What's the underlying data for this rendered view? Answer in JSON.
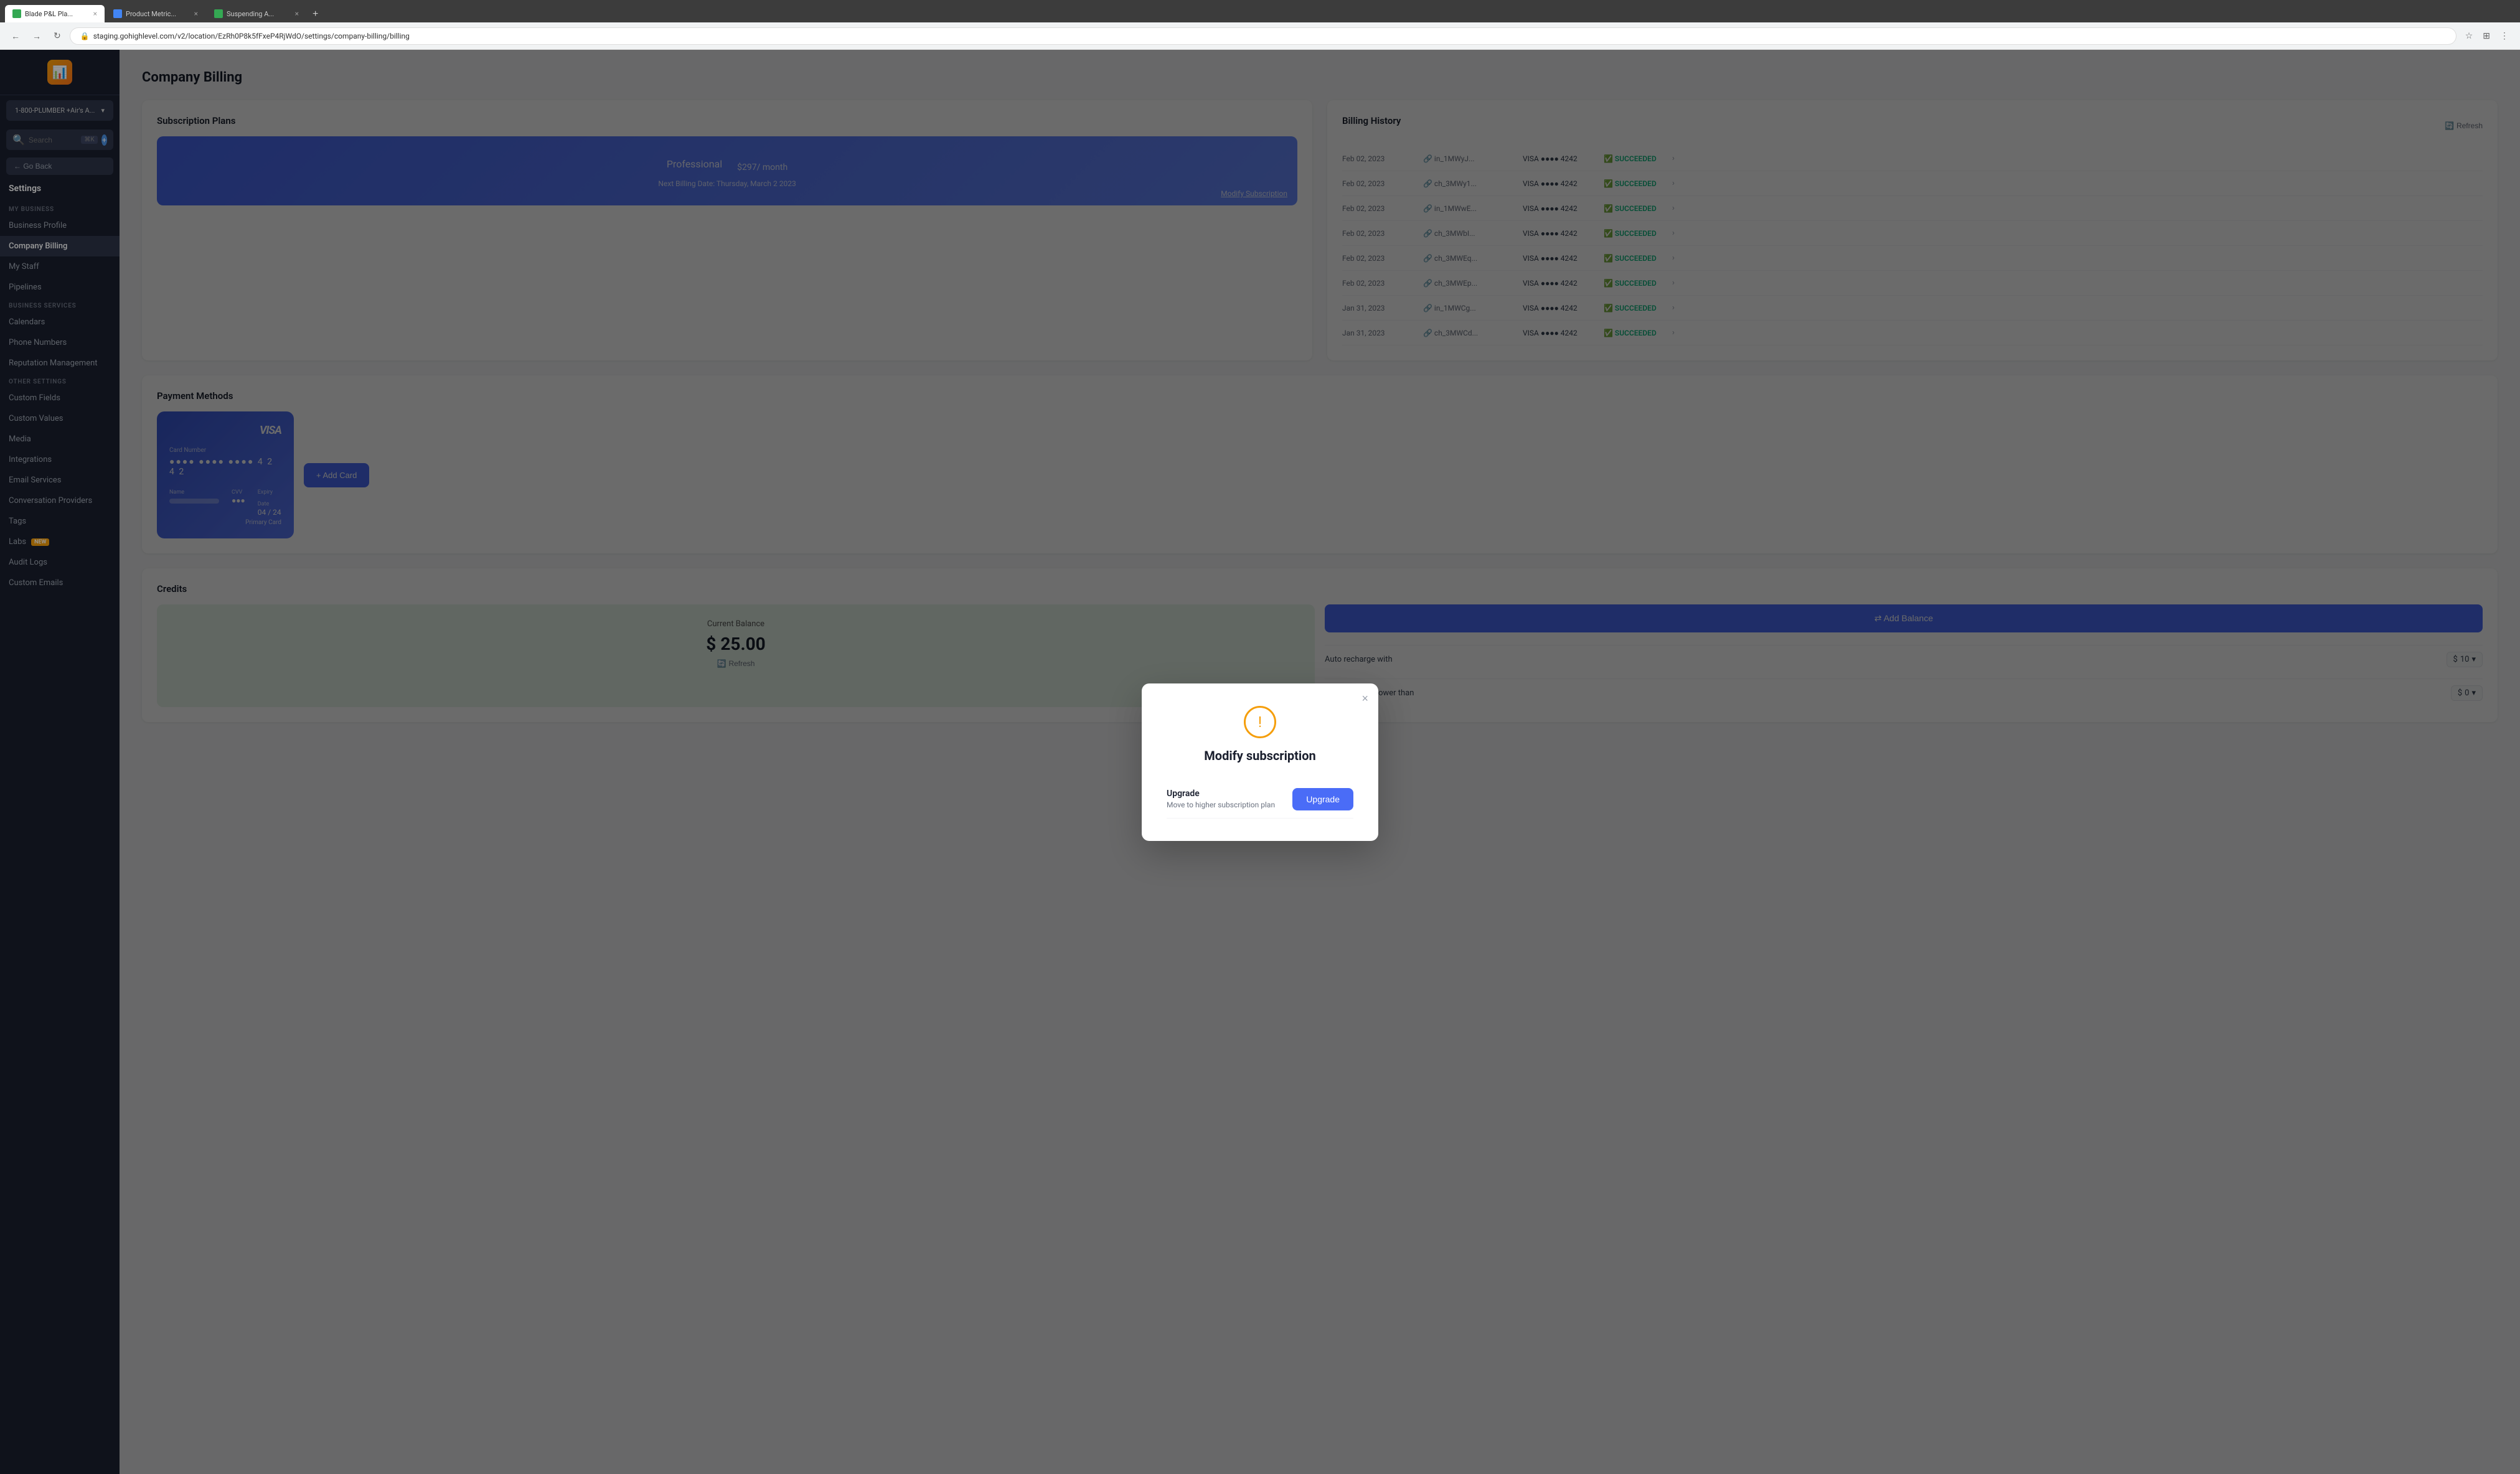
{
  "browser": {
    "url": "staging.gohighlevel.com/v2/location/EzRh0P8k5fFxeP4RjWdO/settings/company-billing/billing",
    "tabs": [
      {
        "label": "Blade P&L Pla...",
        "active": true,
        "color": "green"
      },
      {
        "label": "Product Metric...",
        "active": false,
        "color": "blue"
      },
      {
        "label": "Suspending A...",
        "active": false,
        "color": "green"
      }
    ]
  },
  "sidebar": {
    "logo_emoji": "📊",
    "location": "1-800-PLUMBER +Air's A...",
    "search_placeholder": "Search",
    "search_shortcut": "⌘K",
    "go_back": "← Go Back",
    "settings_label": "Settings",
    "sections": [
      {
        "label": "MY BUSINESS",
        "items": [
          {
            "name": "business-profile",
            "label": "Business Profile",
            "active": false
          },
          {
            "name": "company-billing",
            "label": "Company Billing",
            "active": true
          },
          {
            "name": "my-staff",
            "label": "My Staff",
            "active": false
          },
          {
            "name": "pipelines",
            "label": "Pipelines",
            "active": false
          }
        ]
      },
      {
        "label": "BUSINESS SERVICES",
        "items": [
          {
            "name": "calendars",
            "label": "Calendars",
            "active": false
          },
          {
            "name": "phone-numbers",
            "label": "Phone Numbers",
            "active": false
          },
          {
            "name": "reputation-management",
            "label": "Reputation Management",
            "active": false
          }
        ]
      },
      {
        "label": "OTHER SETTINGS",
        "items": [
          {
            "name": "custom-fields",
            "label": "Custom Fields",
            "active": false
          },
          {
            "name": "custom-values",
            "label": "Custom Values",
            "active": false
          },
          {
            "name": "media",
            "label": "Media",
            "active": false
          },
          {
            "name": "integrations",
            "label": "Integrations",
            "active": false
          },
          {
            "name": "email-services",
            "label": "Email Services",
            "active": false
          },
          {
            "name": "conversation-providers",
            "label": "Conversation Providers",
            "active": false
          },
          {
            "name": "tags",
            "label": "Tags",
            "active": false
          },
          {
            "name": "labs",
            "label": "Labs",
            "active": false,
            "badge": "NEW"
          },
          {
            "name": "audit-logs",
            "label": "Audit Logs",
            "active": false
          },
          {
            "name": "custom-emails",
            "label": "Custom Emails",
            "active": false
          }
        ]
      }
    ]
  },
  "page": {
    "title": "Company Billing"
  },
  "subscription_plans": {
    "title": "Subscription Plans",
    "plan_name": "Professional",
    "plan_price": "$297",
    "plan_period": "/ month",
    "billing_date_label": "Next Billing Date: Thursday, March 2 2023",
    "modify_link": "Modify Subscription"
  },
  "billing_history": {
    "title": "Billing History",
    "refresh_label": "Refresh",
    "rows": [
      {
        "date": "Feb 02, 2023",
        "id": "in_1MWyJ...",
        "card": "VISA ●●●● 4242",
        "status": "SUCCEEDED"
      },
      {
        "date": "Feb 02, 2023",
        "id": "ch_3MWy1...",
        "card": "VISA ●●●● 4242",
        "status": "SUCCEEDED"
      },
      {
        "date": "Feb 02, 2023",
        "id": "in_1MWwE...",
        "card": "VISA ●●●● 4242",
        "status": "SUCCEEDED"
      },
      {
        "date": "Feb 02, 2023",
        "id": "ch_3MWbI...",
        "card": "VISA ●●●● 4242",
        "status": "SUCCEEDED"
      },
      {
        "date": "Feb 02, 2023",
        "id": "ch_3MWEq...",
        "card": "VISA ●●●● 4242",
        "status": "SUCCEEDED"
      },
      {
        "date": "Feb 02, 2023",
        "id": "ch_3MWEp...",
        "card": "VISA ●●●● 4242",
        "status": "SUCCEEDED"
      },
      {
        "date": "Jan 31, 2023",
        "id": "in_1MWCg...",
        "card": "VISA ●●●● 4242",
        "status": "SUCCEEDED"
      },
      {
        "date": "Jan 31, 2023",
        "id": "ch_3MWCd...",
        "card": "VISA ●●●● 4242",
        "status": "SUCCEEDED"
      }
    ]
  },
  "payment_methods": {
    "title": "Payment Methods",
    "card_brand": "VISA",
    "card_number_label": "Card Number",
    "card_number": "●●●●  ●●●●  ●●●●  4 2 4 2",
    "name_label": "Name",
    "name_value": "━━━━━━━━━",
    "cvv_label": "CVV",
    "cvv_value": "●●●",
    "expiry_label": "Expiry Date",
    "expiry_value": "04 / 24",
    "primary_label": "Primary Card",
    "add_card_label": "+ Add Card"
  },
  "credits": {
    "title": "Credits",
    "balance_label": "Current Balance",
    "balance_amount": "$ 25.00",
    "refresh_label": "Refresh",
    "add_balance_label": "⇄ Add Balance",
    "auto_recharge_label": "Auto recharge with",
    "auto_recharge_amount": "10",
    "balance_lower_label": "when balance lower than",
    "balance_lower_amount": "0"
  },
  "modal": {
    "title": "Modify subscription",
    "close_label": "×",
    "icon": "!",
    "option_label": "Upgrade",
    "option_desc": "Move to higher subscription plan",
    "option_btn": "Upgrade"
  },
  "colors": {
    "accent": "#4a6cf7",
    "success": "#10b981",
    "warning": "#f59e0b",
    "sidebar_bg": "#1a1f2e",
    "sidebar_active": "#2d3448"
  }
}
